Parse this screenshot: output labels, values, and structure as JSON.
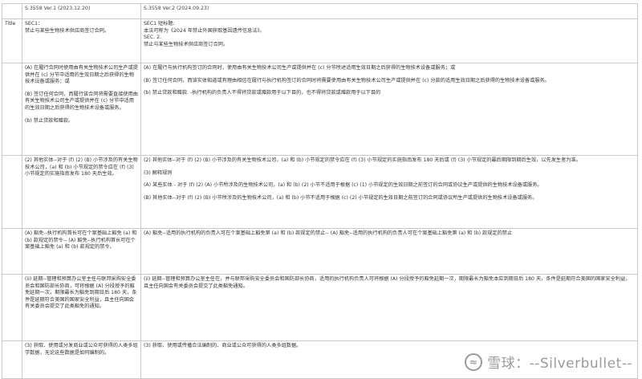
{
  "header": {
    "corner": "",
    "v1": "S.3558 Ver.1 (2023.12.20)",
    "v2": "S.3558 Ver.2 (2024.09.23)"
  },
  "rows": [
    {
      "label": "Title",
      "v1": [
        "SEC1：",
        "禁止与某些生物技术供应商签订合同。"
      ],
      "v2": [
        "SEC1 短标题:",
        "本法可称为《2024 年禁止外国获取基因遗传信息法》。",
        "SEC. 2.",
        "禁止与某些生物技术供应商签订合同。"
      ]
    },
    {
      "label": "",
      "v1": [
        "(A) 在履行合同时使用由有关生物技术公司生产或提供并在 (c) 分节中适用的生效日期之后获得的生物技术设备或服务；或",
        "(B) 签订任何合同，而履行该合同将需要直接使用由有关生物技术公司生产或提供并在 (c) 分节中适用的生效日期之后获得的生物技术设备或服务。",
        "(b) 禁止贷款和赠款。"
      ],
      "v2": [
        "(A) 在履行与执行机构签订的合同时，使用由有关生物技术公司生产或提供并在 (c) 分节所述适用生效日期之后获得的生物技术设备或服务；或",
        "(B) 签订任何合同，而该实体知道或有理由相信在履行与执行机构签订的合同时将需要使用由有关生物技术公司生产或提供并在 (c) 分款的适用生效日期之后获得的生物技术设备或服务。",
        "(b) 禁止贷款和赠款. -执行机构的负责人不得将贷款或赠款用于以下目的，也不得将贷款或赠款用于以下目的"
      ]
    },
    {
      "label": "",
      "v1": [
        "(2) 其他实体--对于 (f) (2) (B) 小节涉及的有关生物技术公司，(a) 和 (b) 小节规定的禁令应在 (f) (3) 小节规定的实施指南发布 180 天后生效。"
      ],
      "v2": [
        "(2) 其他实体--对于 (f) (2) (B) 小节涉及的有关生物技术公司，(a) 和 (b) 小节规定的禁令应在 (f) (3) 小节规定的实施指南发布 180 天后或 (f) (3) 小节规定的最后期限到期后生效，以先发生者为准。",
        "(3) 解释规则",
        "(A) 某些实体 - 对于 (f) (2) (A) 小节所涉及的生物技术公司，(a) 和 (b) (2) 小节不适用于根据 (c) (1) 小节规定的生效日期之前签订的合同或协议生产或提供的生物技术设备或服务。",
        "(B) 其他实体--对于 (f) (2) (B) 小节所涉及的生物技术公司，(a) 和 (b) 小节不适用于根据 (c) (2) 小节规定的生效日期之前签订的合同或协议所生产或提供的生物技术设备或服务。"
      ]
    },
    {
      "label": "",
      "v1": [
        "(A) 豁免--执行机构首长可在个案基础上豁免 (a) 和 (b) 款规定的禁令-- (A) 豁免--执行机构首长可在个案基础上豁免 (a) 和 (b) 款规定的禁令。"
      ],
      "v2": [
        "(A) 豁免--适用的执行机构的负责人可在个案基础上豁免第 (a) 和 (b) 款规定的禁止-- (A) 豁免--适用的执行机构的负责人可在个案基础上豁免第 (a) 和 (b) 款规定的禁止"
      ]
    },
    {
      "label": "",
      "v1": [
        "(ii) 延期--管理和预算办公室主任与联邦采购安全委员会和国防部长协商，可将根据 (A) 分段授予的豁免延期一次，期限最长为豁免到期日后 180 天，条件是延期符合美国的国家安全利益，且主任向国会有关委员会提交了此类豁免的通知。"
      ],
      "v2": [
        "(ii) 延期--管理和预算办公室主任在，并与联邦采购安全委员会和国防部长协商，适用的执行机构负责人可将根据 (A) 分段授予的豁免延期一次，期限最长为豁免本应到期日后 180 天，条件是延期符合美国的国家安全利益，且主任向国会有关委员会提交了此类豁免通知。"
      ]
    },
    {
      "label": "",
      "v1": [
        "(3) 获取、使用或分发商业或公众可获得的人类多组学数据，无论这些数据是如何编制的。"
      ],
      "v2": [
        "(3) 获取、使用或传播合法编制的、商业或公众可获得的人类多组数据。"
      ]
    }
  ],
  "watermark": {
    "logo": "≈",
    "text": "雪球：--Silverbullet--"
  }
}
